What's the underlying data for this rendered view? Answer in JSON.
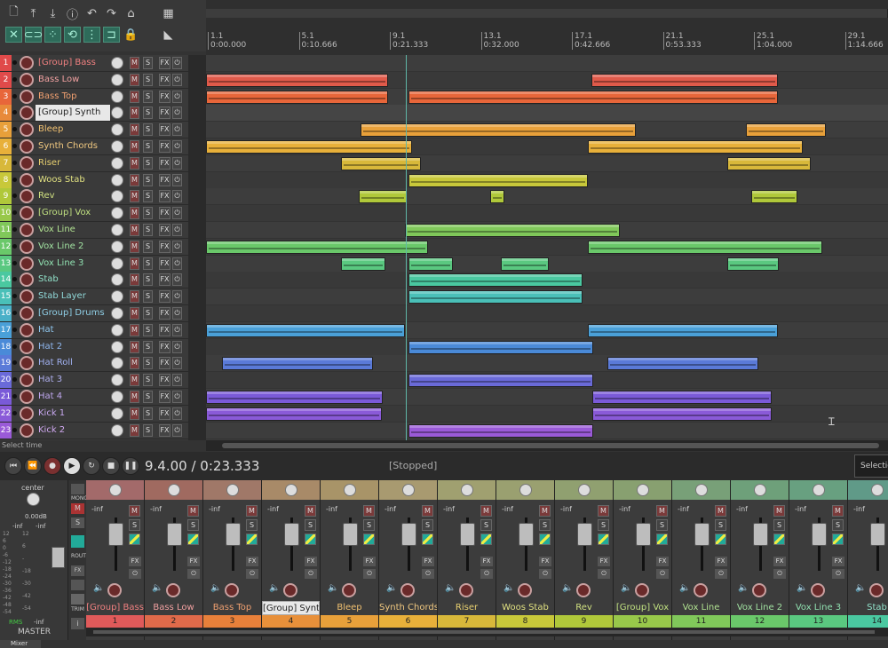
{
  "toolbar": {
    "row1": [
      "new-file-icon",
      "save-icon",
      "download-icon",
      "info-icon",
      "undo-icon",
      "redo-icon",
      "metronome-icon",
      "grid-icon"
    ],
    "row2": [
      "cross-icon",
      "link-icon",
      "grid-dots-icon",
      "loop-icon",
      "snap-icon",
      "cycle-icon",
      "lock-icon",
      "cursor-icon"
    ]
  },
  "ruler": {
    "marks": [
      {
        "bar": "1.1",
        "time": "0:00.000"
      },
      {
        "bar": "5.1",
        "time": "0:10.666"
      },
      {
        "bar": "9.1",
        "time": "0:21.333"
      },
      {
        "bar": "13.1",
        "time": "0:32.000"
      },
      {
        "bar": "17.1",
        "time": "0:42.666"
      },
      {
        "bar": "21.1",
        "time": "0:53.333"
      },
      {
        "bar": "25.1",
        "time": "1:04.000"
      },
      {
        "bar": "29.1",
        "time": "1:14.666"
      }
    ]
  },
  "tracks": [
    {
      "n": "1",
      "name": "[Group] Bass",
      "color": "#e04a4a",
      "text": "#f08080"
    },
    {
      "n": "2",
      "name": "Bass Low",
      "color": "#e04a4a",
      "text": "#f0a0a0"
    },
    {
      "n": "3",
      "name": "Bass Top",
      "color": "#e8663a",
      "text": "#f0a070"
    },
    {
      "n": "4",
      "name": "[Group] Synth",
      "color": "#e88a3a",
      "text": "#222",
      "selected": true
    },
    {
      "n": "5",
      "name": "Bleep",
      "color": "#e8a03a",
      "text": "#f0c070"
    },
    {
      "n": "6",
      "name": "Synth Chords",
      "color": "#e8b03a",
      "text": "#f0c880"
    },
    {
      "n": "7",
      "name": "Riser",
      "color": "#d8b83a",
      "text": "#e8d070"
    },
    {
      "n": "8",
      "name": "Woos Stab",
      "color": "#c8c83a",
      "text": "#e0e080"
    },
    {
      "n": "9",
      "name": "Rev",
      "color": "#b0c83a",
      "text": "#d0e080"
    },
    {
      "n": "10",
      "name": "[Group] Vox",
      "color": "#98c84a",
      "text": "#c0e080"
    },
    {
      "n": "11",
      "name": "Vox Line",
      "color": "#80c85a",
      "text": "#b0e090"
    },
    {
      "n": "12",
      "name": "Vox Line 2",
      "color": "#6ac86a",
      "text": "#a0e0a0"
    },
    {
      "n": "13",
      "name": "Vox Line 3",
      "color": "#5ac880",
      "text": "#90e0b0"
    },
    {
      "n": "14",
      "name": "Stab",
      "color": "#4ac8a0",
      "text": "#90e0c8"
    },
    {
      "n": "15",
      "name": "Stab Layer",
      "color": "#4ac0b8",
      "text": "#90d8d8"
    },
    {
      "n": "16",
      "name": "[Group] Drums",
      "color": "#4ab0c8",
      "text": "#90d0e8"
    },
    {
      "n": "17",
      "name": "Hat",
      "color": "#4aa0d8",
      "text": "#90c8f0"
    },
    {
      "n": "18",
      "name": "Hat 2",
      "color": "#4a8ad8",
      "text": "#90b8f0"
    },
    {
      "n": "19",
      "name": "Hat Roll",
      "color": "#5a7ad8",
      "text": "#a0b0f0"
    },
    {
      "n": "20",
      "name": "Hat 3",
      "color": "#6a6ad8",
      "text": "#b0b0f0"
    },
    {
      "n": "21",
      "name": "Hat 4",
      "color": "#7a5ad8",
      "text": "#c0a8f0"
    },
    {
      "n": "22",
      "name": "Kick 1",
      "color": "#8a5ad8",
      "text": "#c8a8f0"
    },
    {
      "n": "23",
      "name": "Kick 2",
      "color": "#9a5ad8",
      "text": "#d0a8f0"
    }
  ],
  "buttons": {
    "m": "M",
    "s": "S",
    "fx": "FX"
  },
  "items": [
    [],
    [
      [
        0,
        205,
        "#e05a4a"
      ],
      [
        434,
        210,
        "#e05a4a"
      ]
    ],
    [
      [
        0,
        205,
        "#e8663a"
      ],
      [
        228,
        416,
        "#e8663a"
      ]
    ],
    [],
    [
      [
        174,
        310,
        "#e8a03a"
      ],
      [
        608,
        90,
        "#e8a03a"
      ]
    ],
    [
      [
        0,
        232,
        "#e8b03a"
      ],
      [
        430,
        242,
        "#e8b03a"
      ]
    ],
    [
      [
        152,
        90,
        "#d8b83a"
      ],
      [
        587,
        94,
        "#d8b83a"
      ]
    ],
    [
      [
        228,
        202,
        "#c8c83a"
      ]
    ],
    [
      [
        172,
        54,
        "#b0c83a"
      ],
      [
        320,
        16,
        "#b0c83a"
      ],
      [
        614,
        52,
        "#b0c83a"
      ]
    ],
    [],
    [
      [
        224,
        242,
        "#80c85a"
      ]
    ],
    [
      [
        0,
        250,
        "#6ac86a"
      ],
      [
        430,
        264,
        "#6ac86a"
      ]
    ],
    [
      [
        152,
        50,
        "#5ac880"
      ],
      [
        228,
        50,
        "#5ac880"
      ],
      [
        332,
        54,
        "#5ac880"
      ],
      [
        587,
        58,
        "#5ac880"
      ]
    ],
    [
      [
        228,
        196,
        "#4ac8a0"
      ]
    ],
    [
      [
        228,
        196,
        "#4ac0b8"
      ]
    ],
    [],
    [
      [
        0,
        224,
        "#4aa0d8"
      ],
      [
        430,
        214,
        "#4aa0d8"
      ]
    ],
    [
      [
        228,
        208,
        "#4a8ad8"
      ]
    ],
    [
      [
        18,
        170,
        "#5a7ad8"
      ],
      [
        452,
        170,
        "#5a7ad8"
      ]
    ],
    [
      [
        228,
        208,
        "#6a6ad8"
      ]
    ],
    [
      [
        0,
        199,
        "#7a5ad8"
      ],
      [
        435,
        202,
        "#7a5ad8"
      ]
    ],
    [
      [
        0,
        198,
        "#8a5ad8"
      ],
      [
        435,
        202,
        "#8a5ad8"
      ]
    ],
    [
      [
        228,
        208,
        "#9a5ad8"
      ]
    ]
  ],
  "status": {
    "hint": "Select time"
  },
  "transport": {
    "time": "9.4.00 / 0:23.333",
    "state": "[Stopped]",
    "selection": "Selectio"
  },
  "master": {
    "pan": "center",
    "db": "0.00dB",
    "l": "-inf",
    "r": "-inf",
    "scale": [
      "12",
      "6",
      "0",
      "-6",
      "-12",
      "-18",
      "-24",
      "-30",
      "-36",
      "-42",
      "-48",
      "-54"
    ],
    "scale_right": [
      "12",
      "6",
      "-",
      "-18",
      "-30",
      "-42",
      "-54"
    ],
    "rms": "RMS",
    "rms_val": "-inf",
    "label": "MASTER"
  },
  "mixer_side": {
    "mono": "MONO",
    "route": "ROUTE",
    "trim": "TRIM",
    "i": "i"
  },
  "strips": [
    {
      "name": "[Group] Bass",
      "num": "1",
      "color": "#e05a5a",
      "head": "#a36a6a",
      "text": "#f08080"
    },
    {
      "name": "Bass Low",
      "num": "2",
      "color": "#e06a4a",
      "head": "#a06a60",
      "text": "#f0a0a0"
    },
    {
      "name": "Bass Top",
      "num": "3",
      "color": "#e8803a",
      "head": "#a07868",
      "text": "#f0a070"
    },
    {
      "name": "[Group] Synt",
      "num": "4",
      "color": "#e8903a",
      "head": "#a88a68",
      "text": "#222",
      "selected": true
    },
    {
      "name": "Bleep",
      "num": "5",
      "color": "#e8a03a",
      "head": "#a89468",
      "text": "#f0c070"
    },
    {
      "name": "Synth Chords",
      "num": "6",
      "color": "#e8b03a",
      "head": "#a89a70",
      "text": "#f0c880"
    },
    {
      "name": "Riser",
      "num": "7",
      "color": "#d8b83a",
      "head": "#a0a070",
      "text": "#e8d070"
    },
    {
      "name": "Woos Stab",
      "num": "8",
      "color": "#c8c83a",
      "head": "#9aa070",
      "text": "#e0e080"
    },
    {
      "name": "Rev",
      "num": "9",
      "color": "#b0c83a",
      "head": "#90a070",
      "text": "#d0e080"
    },
    {
      "name": "[Group] Vox",
      "num": "10",
      "color": "#98c84a",
      "head": "#88a070",
      "text": "#c0e080"
    },
    {
      "name": "Vox Line",
      "num": "11",
      "color": "#80c85a",
      "head": "#78a078",
      "text": "#b0e090"
    },
    {
      "name": "Vox Line 2",
      "num": "12",
      "color": "#6ac86a",
      "head": "#6ea07a",
      "text": "#a0e0a0"
    },
    {
      "name": "Vox Line 3",
      "num": "13",
      "color": "#5ac880",
      "head": "#68a080",
      "text": "#90e0b0"
    },
    {
      "name": "Stab",
      "num": "14",
      "color": "#4ac8a0",
      "head": "#609a88",
      "text": "#90e0c8"
    }
  ],
  "strip_common": {
    "inf": "-inf",
    "fx": "FX"
  },
  "mixer_tab": "Mixer"
}
